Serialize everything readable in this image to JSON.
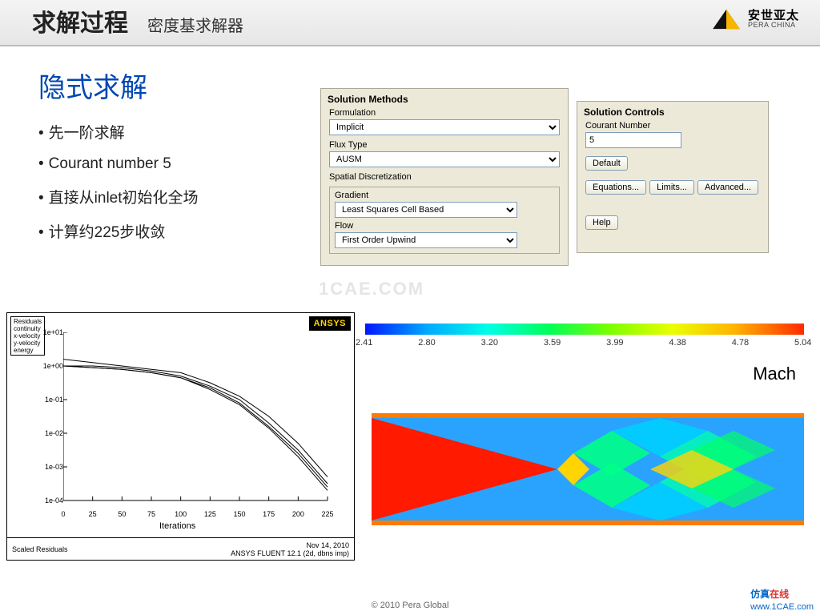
{
  "header": {
    "title": "求解过程",
    "subtitle": "密度基求解器"
  },
  "logo": {
    "cn": "安世亚太",
    "en": "PERA CHINA"
  },
  "slide": {
    "title": "隐式求解",
    "bullets": [
      "先一阶求解",
      "Courant number 5",
      "直接从inlet初始化全场",
      "计算约225步收敛"
    ]
  },
  "sol_methods": {
    "title": "Solution Methods",
    "formulation_label": "Formulation",
    "formulation": "Implicit",
    "flux_label": "Flux Type",
    "flux": "AUSM",
    "spatial_label": "Spatial Discretization",
    "gradient_label": "Gradient",
    "gradient": "Least Squares Cell Based",
    "flow_label": "Flow",
    "flow": "First Order Upwind"
  },
  "sol_controls": {
    "title": "Solution Controls",
    "courant_label": "Courant Number",
    "courant": "5",
    "btn_default": "Default",
    "btn_eq": "Equations...",
    "btn_lim": "Limits...",
    "btn_adv": "Advanced...",
    "btn_help": "Help"
  },
  "residual": {
    "legend": [
      "Residuals",
      "continuity",
      "x-velocity",
      "y-velocity",
      "energy"
    ],
    "ansys": "ANSYS",
    "xlabel": "Iterations",
    "footer_left": "Scaled Residuals",
    "footer_date": "Nov 14, 2010",
    "footer_ver": "ANSYS FLUENT 12.1 (2d, dbns imp)"
  },
  "mach": {
    "label": "Mach"
  },
  "colorbar_ticks": [
    "2.41",
    "2.80",
    "3.20",
    "3.59",
    "3.99",
    "4.38",
    "4.78",
    "5.04"
  ],
  "copyright": "© 2010 Pera Global",
  "watermark": {
    "center": "1CAE.COM",
    "brand1": "仿真",
    "brand2": "在线",
    "url": "www.1CAE.com"
  },
  "chart_data": {
    "type": "line",
    "title": "Scaled Residuals",
    "xlabel": "Iterations",
    "ylabel": "",
    "xlim": [
      0,
      225
    ],
    "ylim_log10": [
      -4,
      1
    ],
    "xticks": [
      0,
      25,
      50,
      75,
      100,
      125,
      150,
      175,
      200,
      225
    ],
    "yticks": [
      "1e+01",
      "1e+00",
      "1e-01",
      "1e-02",
      "1e-03",
      "1e-04"
    ],
    "series": [
      {
        "name": "continuity",
        "x": [
          0,
          25,
          50,
          75,
          100,
          125,
          150,
          175,
          200,
          225
        ],
        "y_log10": [
          0.2,
          0.1,
          0.0,
          -0.1,
          -0.2,
          -0.5,
          -0.9,
          -1.5,
          -2.3,
          -3.3
        ]
      },
      {
        "name": "x-velocity",
        "x": [
          0,
          25,
          50,
          75,
          100,
          125,
          150,
          175,
          200,
          225
        ],
        "y_log10": [
          0.0,
          0.0,
          -0.05,
          -0.15,
          -0.3,
          -0.6,
          -1.0,
          -1.7,
          -2.5,
          -3.5
        ]
      },
      {
        "name": "y-velocity",
        "x": [
          0,
          25,
          50,
          75,
          100,
          125,
          150,
          175,
          200,
          225
        ],
        "y_log10": [
          0.0,
          -0.05,
          -0.1,
          -0.2,
          -0.35,
          -0.65,
          -1.1,
          -1.8,
          -2.6,
          -3.6
        ]
      },
      {
        "name": "energy",
        "x": [
          0,
          25,
          50,
          75,
          100,
          125,
          150,
          175,
          200,
          225
        ],
        "y_log10": [
          0.0,
          -0.05,
          -0.1,
          -0.2,
          -0.35,
          -0.7,
          -1.15,
          -1.85,
          -2.7,
          -3.7
        ]
      }
    ]
  }
}
